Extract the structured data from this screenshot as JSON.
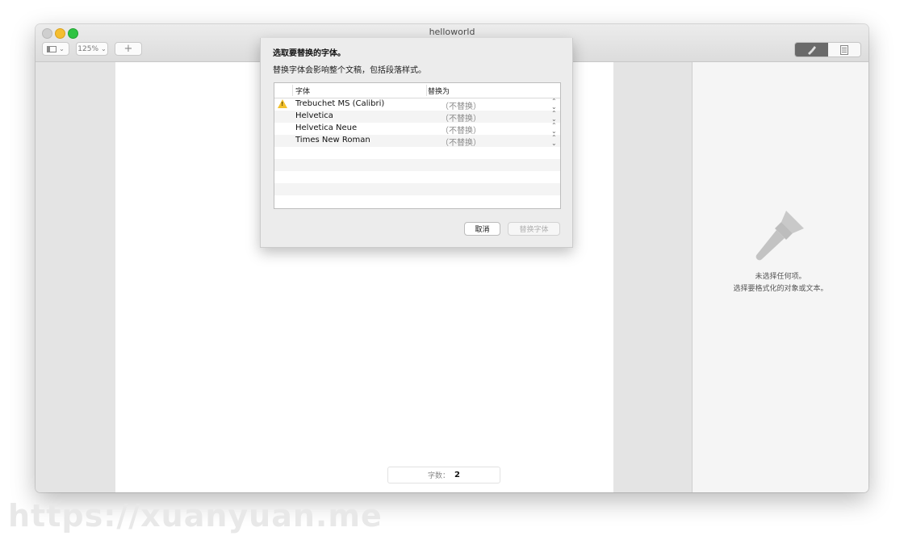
{
  "window": {
    "title": "helloworld"
  },
  "toolbar": {
    "zoom": "125%",
    "add_symbol": "+"
  },
  "dialog": {
    "title": "选取要替换的字体。",
    "description": "替换字体会影响整个文稿，包括段落样式。",
    "columns": {
      "font": "字体",
      "replace_with": "替换为"
    },
    "rows": [
      {
        "font": "Trebuchet MS (Calibri)",
        "replace": "（不替换）",
        "warning": true
      },
      {
        "font": "Helvetica",
        "replace": "（不替换）",
        "warning": false
      },
      {
        "font": "Helvetica Neue",
        "replace": "（不替换）",
        "warning": false
      },
      {
        "font": "Times New Roman",
        "replace": "（不替换）",
        "warning": false
      }
    ],
    "cancel_label": "取消",
    "replace_label": "替换字体",
    "warning_glyph": "!"
  },
  "inspector": {
    "no_selection": "未选择任何项。",
    "hint": "选择要格式化的对象或文本。"
  },
  "word_count": {
    "label": "字数：",
    "value": "2"
  },
  "watermark": "https://xuanyuan.me",
  "colors": {
    "accent": "#f3c12d",
    "window_bg": "#ececec"
  }
}
